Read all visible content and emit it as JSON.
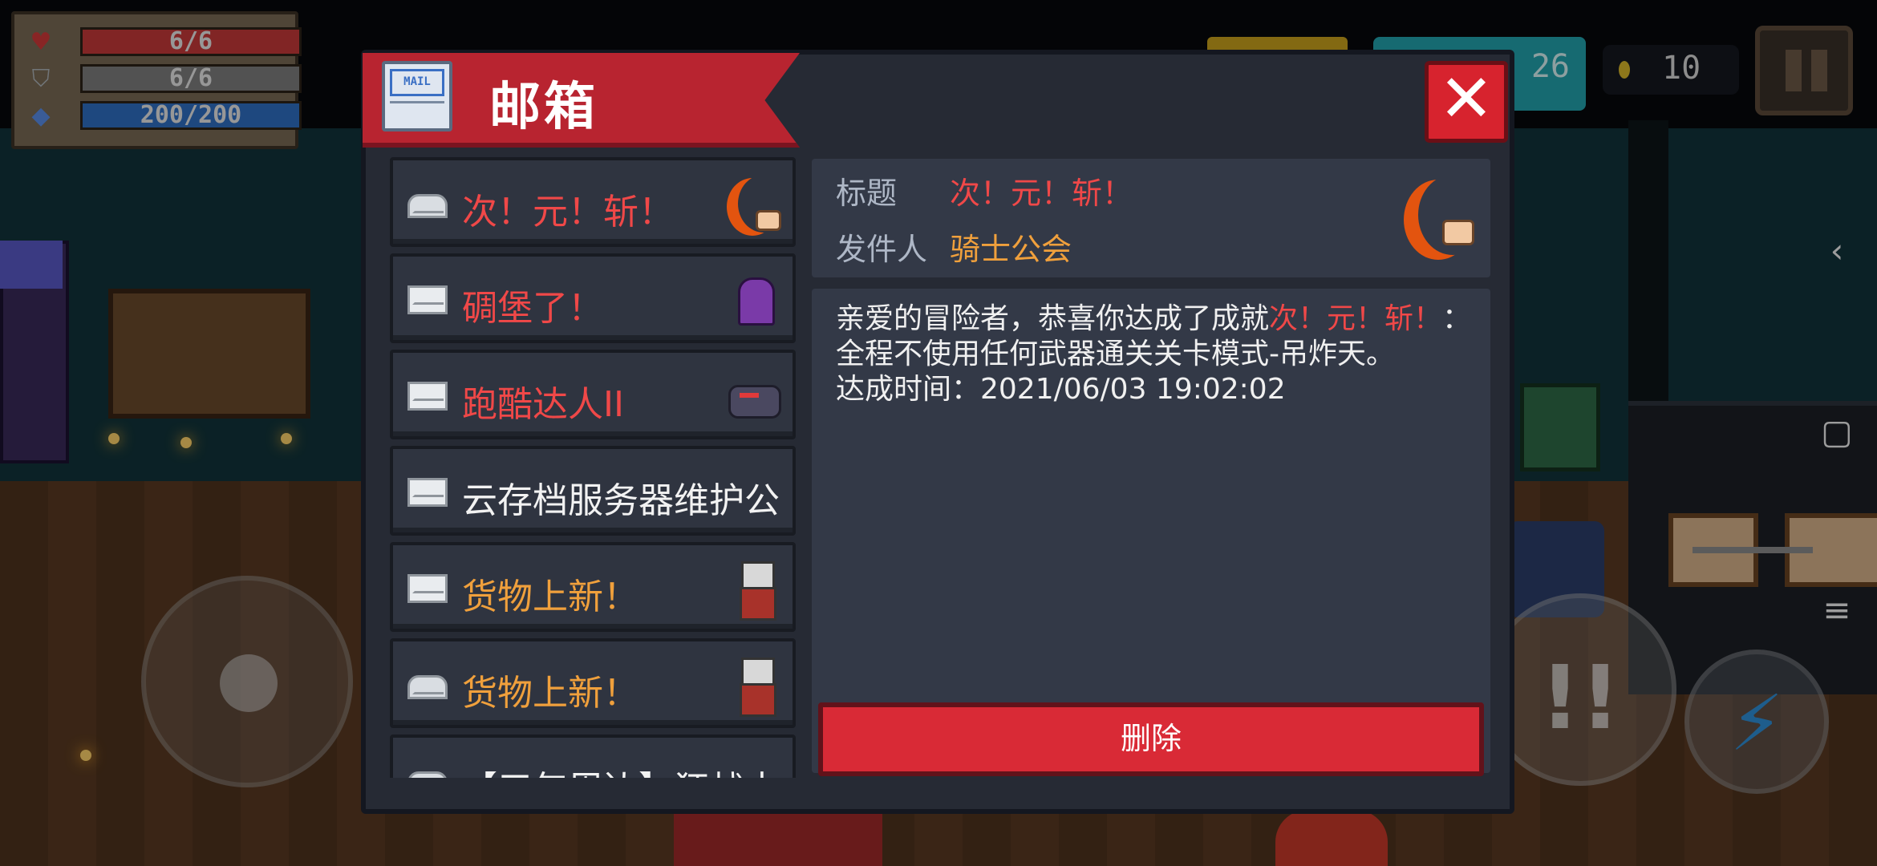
{
  "hud": {
    "hp": "6/6",
    "armor": "6/6",
    "energy": "200/200",
    "gems_partial": "26",
    "coins": "10",
    "icons": {
      "hp": "heart-icon",
      "armor": "shield-icon",
      "energy": "diamond-icon",
      "coin": "coin-icon",
      "pause": "pause-icon"
    }
  },
  "mailbox": {
    "title": "邮箱",
    "close_label": "✕",
    "items": [
      {
        "subject": "次！元！斩！",
        "color": "#f04848",
        "opened": true,
        "thumb": "crescent-blade-icon"
      },
      {
        "subject": "碉堡了！",
        "color": "#f04848",
        "opened": false,
        "thumb": "purple-ghost-icon"
      },
      {
        "subject": "跑酷达人II",
        "color": "#f04848",
        "opened": false,
        "thumb": "shadow-creature-icon"
      },
      {
        "subject": "云存档服务器维护公",
        "color": "#f2f2f2",
        "opened": false,
        "thumb": ""
      },
      {
        "subject": "货物上新！",
        "color": "#f0a03c",
        "opened": false,
        "thumb": "cat-merchant-icon"
      },
      {
        "subject": "货物上新！",
        "color": "#f0a03c",
        "opened": true,
        "thumb": "cat-merchant-icon"
      },
      {
        "subject": "【三年周边】狂战士",
        "color": "#f2f2f2",
        "opened": true,
        "thumb": ""
      }
    ],
    "detail": {
      "title_label": "标题",
      "title_value": "次！元！斩！",
      "sender_label": "发件人",
      "sender_value": "骑士公会",
      "body_pre": "亲爱的冒险者，恭喜你达成了成就",
      "body_highlight": "次！元！斩！",
      "body_post": "：全程不使用任何武器通关关卡模式-吊炸天。",
      "achieved_time": "达成时间：2021/06/03 19:02:02",
      "delete_label": "删除"
    }
  },
  "controls": {
    "attack_label": "!!",
    "skill_label": "⚡"
  },
  "system_nav": {
    "back": "‹",
    "home": "▢",
    "menu": "≡"
  },
  "colors": {
    "accent_red": "#d92a36",
    "header_red": "#b82430",
    "panel": "#333947",
    "orange": "#f0a03c"
  }
}
